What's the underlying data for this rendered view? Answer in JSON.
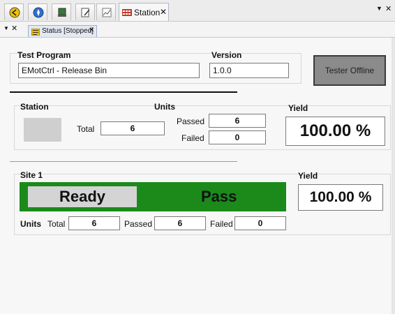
{
  "top_tabs": {
    "icon_tabs": [
      "back-icon",
      "compass-icon",
      "device-icon",
      "edit-icon",
      "chart-icon"
    ],
    "station": {
      "label": "Station",
      "icon": "station-icon"
    }
  },
  "doc_tab": {
    "label": "Status [Stopped]"
  },
  "test_program": {
    "label": "Test Program",
    "value": "EMotCtrl - Release Bin",
    "version_label": "Version",
    "version_value": "1.0.0"
  },
  "tester_button": "Tester Offline",
  "station_section": {
    "label": "Station",
    "units_label": "Units",
    "total_label": "Total",
    "total": "6",
    "passed_label": "Passed",
    "passed": "6",
    "failed_label": "Failed",
    "failed": "0",
    "yield_label": "Yield",
    "yield": "100.00 %"
  },
  "site": {
    "label": "Site 1",
    "status": "Ready",
    "result": "Pass",
    "yield_label": "Yield",
    "yield": "100.00 %",
    "units_label": "Units",
    "total_label": "Total",
    "total": "6",
    "passed_label": "Passed",
    "passed": "6",
    "failed_label": "Failed",
    "failed": "0"
  },
  "colors": {
    "pass_green": "#1b8a1b",
    "ready_gray": "#d4d4d4",
    "offline_gray": "#8b8b8b"
  }
}
